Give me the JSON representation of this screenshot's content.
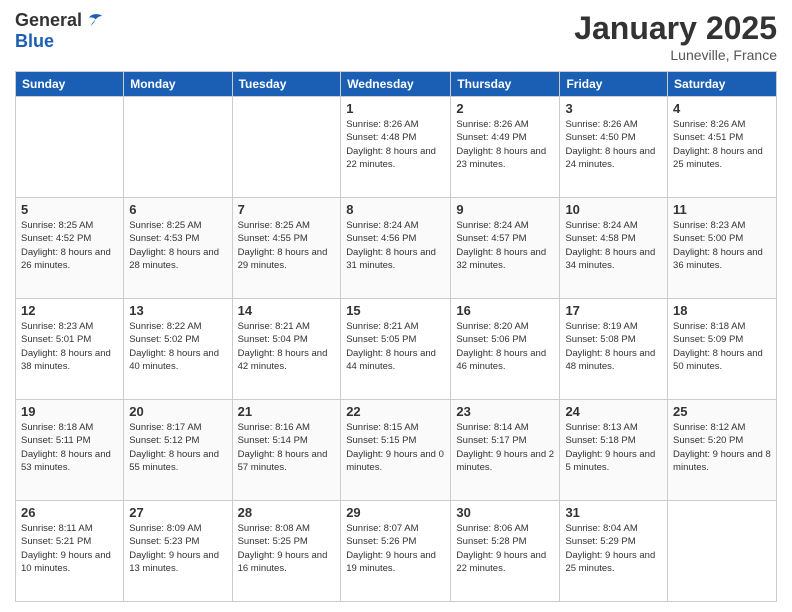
{
  "logo": {
    "general": "General",
    "blue": "Blue"
  },
  "header": {
    "title": "January 2025",
    "subtitle": "Luneville, France"
  },
  "weekdays": [
    "Sunday",
    "Monday",
    "Tuesday",
    "Wednesday",
    "Thursday",
    "Friday",
    "Saturday"
  ],
  "weeks": [
    [
      {
        "day": "",
        "sunrise": "",
        "sunset": "",
        "daylight": ""
      },
      {
        "day": "",
        "sunrise": "",
        "sunset": "",
        "daylight": ""
      },
      {
        "day": "",
        "sunrise": "",
        "sunset": "",
        "daylight": ""
      },
      {
        "day": "1",
        "sunrise": "Sunrise: 8:26 AM",
        "sunset": "Sunset: 4:48 PM",
        "daylight": "Daylight: 8 hours and 22 minutes."
      },
      {
        "day": "2",
        "sunrise": "Sunrise: 8:26 AM",
        "sunset": "Sunset: 4:49 PM",
        "daylight": "Daylight: 8 hours and 23 minutes."
      },
      {
        "day": "3",
        "sunrise": "Sunrise: 8:26 AM",
        "sunset": "Sunset: 4:50 PM",
        "daylight": "Daylight: 8 hours and 24 minutes."
      },
      {
        "day": "4",
        "sunrise": "Sunrise: 8:26 AM",
        "sunset": "Sunset: 4:51 PM",
        "daylight": "Daylight: 8 hours and 25 minutes."
      }
    ],
    [
      {
        "day": "5",
        "sunrise": "Sunrise: 8:25 AM",
        "sunset": "Sunset: 4:52 PM",
        "daylight": "Daylight: 8 hours and 26 minutes."
      },
      {
        "day": "6",
        "sunrise": "Sunrise: 8:25 AM",
        "sunset": "Sunset: 4:53 PM",
        "daylight": "Daylight: 8 hours and 28 minutes."
      },
      {
        "day": "7",
        "sunrise": "Sunrise: 8:25 AM",
        "sunset": "Sunset: 4:55 PM",
        "daylight": "Daylight: 8 hours and 29 minutes."
      },
      {
        "day": "8",
        "sunrise": "Sunrise: 8:24 AM",
        "sunset": "Sunset: 4:56 PM",
        "daylight": "Daylight: 8 hours and 31 minutes."
      },
      {
        "day": "9",
        "sunrise": "Sunrise: 8:24 AM",
        "sunset": "Sunset: 4:57 PM",
        "daylight": "Daylight: 8 hours and 32 minutes."
      },
      {
        "day": "10",
        "sunrise": "Sunrise: 8:24 AM",
        "sunset": "Sunset: 4:58 PM",
        "daylight": "Daylight: 8 hours and 34 minutes."
      },
      {
        "day": "11",
        "sunrise": "Sunrise: 8:23 AM",
        "sunset": "Sunset: 5:00 PM",
        "daylight": "Daylight: 8 hours and 36 minutes."
      }
    ],
    [
      {
        "day": "12",
        "sunrise": "Sunrise: 8:23 AM",
        "sunset": "Sunset: 5:01 PM",
        "daylight": "Daylight: 8 hours and 38 minutes."
      },
      {
        "day": "13",
        "sunrise": "Sunrise: 8:22 AM",
        "sunset": "Sunset: 5:02 PM",
        "daylight": "Daylight: 8 hours and 40 minutes."
      },
      {
        "day": "14",
        "sunrise": "Sunrise: 8:21 AM",
        "sunset": "Sunset: 5:04 PM",
        "daylight": "Daylight: 8 hours and 42 minutes."
      },
      {
        "day": "15",
        "sunrise": "Sunrise: 8:21 AM",
        "sunset": "Sunset: 5:05 PM",
        "daylight": "Daylight: 8 hours and 44 minutes."
      },
      {
        "day": "16",
        "sunrise": "Sunrise: 8:20 AM",
        "sunset": "Sunset: 5:06 PM",
        "daylight": "Daylight: 8 hours and 46 minutes."
      },
      {
        "day": "17",
        "sunrise": "Sunrise: 8:19 AM",
        "sunset": "Sunset: 5:08 PM",
        "daylight": "Daylight: 8 hours and 48 minutes."
      },
      {
        "day": "18",
        "sunrise": "Sunrise: 8:18 AM",
        "sunset": "Sunset: 5:09 PM",
        "daylight": "Daylight: 8 hours and 50 minutes."
      }
    ],
    [
      {
        "day": "19",
        "sunrise": "Sunrise: 8:18 AM",
        "sunset": "Sunset: 5:11 PM",
        "daylight": "Daylight: 8 hours and 53 minutes."
      },
      {
        "day": "20",
        "sunrise": "Sunrise: 8:17 AM",
        "sunset": "Sunset: 5:12 PM",
        "daylight": "Daylight: 8 hours and 55 minutes."
      },
      {
        "day": "21",
        "sunrise": "Sunrise: 8:16 AM",
        "sunset": "Sunset: 5:14 PM",
        "daylight": "Daylight: 8 hours and 57 minutes."
      },
      {
        "day": "22",
        "sunrise": "Sunrise: 8:15 AM",
        "sunset": "Sunset: 5:15 PM",
        "daylight": "Daylight: 9 hours and 0 minutes."
      },
      {
        "day": "23",
        "sunrise": "Sunrise: 8:14 AM",
        "sunset": "Sunset: 5:17 PM",
        "daylight": "Daylight: 9 hours and 2 minutes."
      },
      {
        "day": "24",
        "sunrise": "Sunrise: 8:13 AM",
        "sunset": "Sunset: 5:18 PM",
        "daylight": "Daylight: 9 hours and 5 minutes."
      },
      {
        "day": "25",
        "sunrise": "Sunrise: 8:12 AM",
        "sunset": "Sunset: 5:20 PM",
        "daylight": "Daylight: 9 hours and 8 minutes."
      }
    ],
    [
      {
        "day": "26",
        "sunrise": "Sunrise: 8:11 AM",
        "sunset": "Sunset: 5:21 PM",
        "daylight": "Daylight: 9 hours and 10 minutes."
      },
      {
        "day": "27",
        "sunrise": "Sunrise: 8:09 AM",
        "sunset": "Sunset: 5:23 PM",
        "daylight": "Daylight: 9 hours and 13 minutes."
      },
      {
        "day": "28",
        "sunrise": "Sunrise: 8:08 AM",
        "sunset": "Sunset: 5:25 PM",
        "daylight": "Daylight: 9 hours and 16 minutes."
      },
      {
        "day": "29",
        "sunrise": "Sunrise: 8:07 AM",
        "sunset": "Sunset: 5:26 PM",
        "daylight": "Daylight: 9 hours and 19 minutes."
      },
      {
        "day": "30",
        "sunrise": "Sunrise: 8:06 AM",
        "sunset": "Sunset: 5:28 PM",
        "daylight": "Daylight: 9 hours and 22 minutes."
      },
      {
        "day": "31",
        "sunrise": "Sunrise: 8:04 AM",
        "sunset": "Sunset: 5:29 PM",
        "daylight": "Daylight: 9 hours and 25 minutes."
      },
      {
        "day": "",
        "sunrise": "",
        "sunset": "",
        "daylight": ""
      }
    ]
  ]
}
